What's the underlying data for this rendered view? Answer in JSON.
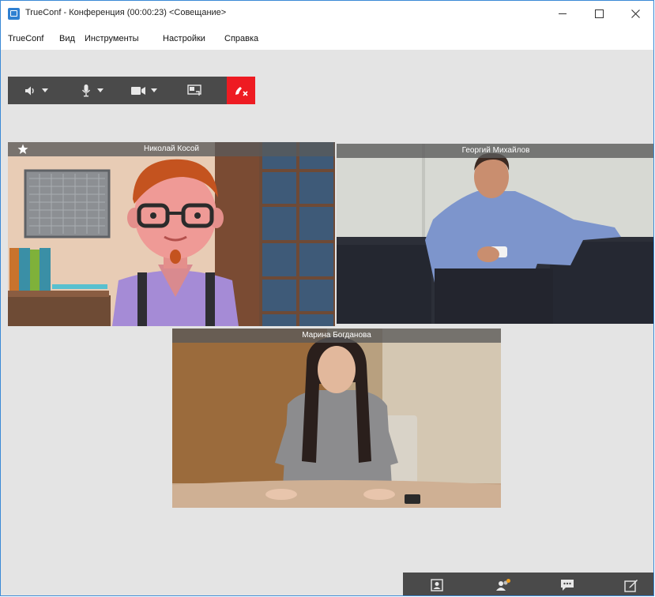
{
  "window": {
    "title": "TrueConf - Конференция (00:00:23) <Совещание>",
    "app_icon": "trueconf-logo-icon",
    "controls": [
      "minimize-icon",
      "maximize-icon",
      "close-icon"
    ]
  },
  "menu": {
    "items": [
      {
        "label": "TrueConf"
      },
      {
        "label": "Вид"
      },
      {
        "label": "Инструменты"
      },
      {
        "label": "Настройки"
      },
      {
        "label": "Справка"
      }
    ]
  },
  "toolbar": {
    "items": [
      {
        "icon": "speaker-icon",
        "dropdown": true
      },
      {
        "icon": "microphone-icon",
        "dropdown": true
      },
      {
        "icon": "camera-icon",
        "dropdown": true
      },
      {
        "icon": "share-screen-icon",
        "dropdown": false
      },
      {
        "icon": "hangup-icon",
        "dropdown": false
      }
    ],
    "hangup_color": "#ee1b22"
  },
  "participants": [
    {
      "name": "Николай Косой",
      "featured": true,
      "badge_icon": "star-icon"
    },
    {
      "name": "Георгий Михайлов",
      "featured": false
    },
    {
      "name": "Марина Богданова",
      "featured": false
    }
  ],
  "bottom_bar": {
    "items": [
      {
        "icon": "self-view-icon"
      },
      {
        "icon": "participants-icon"
      },
      {
        "icon": "chat-icon"
      },
      {
        "icon": "edit-icon"
      }
    ]
  },
  "colors": {
    "window_border": "#3b8ad6",
    "background": "#e4e4e4",
    "toolbar": "#4a4a4a",
    "name_bar": "#5a5a5a"
  }
}
